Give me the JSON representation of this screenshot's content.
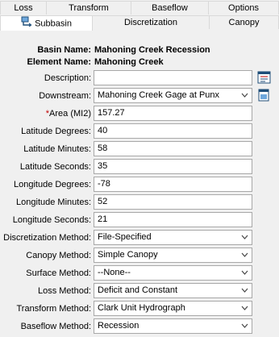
{
  "tabs_row1": [
    "Loss",
    "Transform",
    "Baseflow",
    "Options"
  ],
  "tabs_row2": [
    "Subbasin",
    "Discretization",
    "Canopy"
  ],
  "basin": {
    "basin_name_label": "Basin Name:",
    "basin_name": "Mahoning Creek Recession",
    "element_name_label": "Element Name:",
    "element_name": "Mahoning Creek"
  },
  "fields": {
    "description_label": "Description:",
    "description_value": "",
    "downstream_label": "Downstream:",
    "downstream_value": "Mahoning Creek Gage at Punx",
    "area_required_mark": "*",
    "area_label": "Area (MI2)",
    "area_value": "157.27",
    "lat_deg_label": "Latitude Degrees:",
    "lat_deg_value": "40",
    "lat_min_label": "Latitude Minutes:",
    "lat_min_value": "58",
    "lat_sec_label": "Latitude Seconds:",
    "lat_sec_value": "35",
    "lon_deg_label": "Longitude Degrees:",
    "lon_deg_value": "-78",
    "lon_min_label": "Longitude Minutes:",
    "lon_min_value": "52",
    "lon_sec_label": "Longitude Seconds:",
    "lon_sec_value": "21",
    "discretization_label": "Discretization Method:",
    "discretization_value": "File-Specified",
    "canopy_label": "Canopy Method:",
    "canopy_value": "Simple Canopy",
    "surface_label": "Surface Method:",
    "surface_value": "--None--",
    "loss_label": "Loss Method:",
    "loss_value": "Deficit and Constant",
    "transform_label": "Transform Method:",
    "transform_value": "Clark Unit Hydrograph",
    "baseflow_label": "Baseflow Method:",
    "baseflow_value": "Recession"
  },
  "icons": {
    "subbasin_tab": "subbasin-icon",
    "description_edit": "edit-description-icon",
    "downstream_select": "select-element-icon",
    "dropdown": "chevron-down-icon"
  },
  "colors": {
    "required_mark": "#c00000",
    "background": "#f0f0f0",
    "active_tab": "#ffffff"
  }
}
